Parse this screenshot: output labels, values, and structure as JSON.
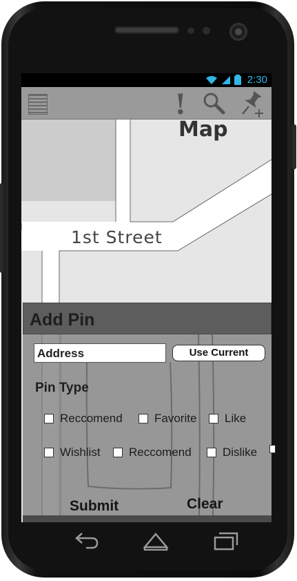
{
  "status_bar": {
    "time": "2:30",
    "icons": [
      "wifi-icon",
      "signal-icon",
      "battery-icon"
    ]
  },
  "action_bar": {
    "icons": [
      "menu-icon",
      "alert-icon",
      "search-icon",
      "add-pin-icon"
    ],
    "alert_glyph": "!"
  },
  "map": {
    "title": "Map",
    "street_label": "1st Street"
  },
  "add_pin": {
    "title": "Add Pin",
    "address_placeholder": "Address",
    "use_current_label": "Use Current",
    "pin_type_label": "Pin Type",
    "options": [
      {
        "label": "Reccomend",
        "checked": false
      },
      {
        "label": "Favorite",
        "checked": false
      },
      {
        "label": "Like",
        "checked": false
      },
      {
        "label": "Wishlist",
        "checked": false
      },
      {
        "label": "Reccomend",
        "checked": false
      },
      {
        "label": "Dislike",
        "checked": false
      }
    ],
    "submit_label": "Submit",
    "clear_label": "Clear"
  },
  "nav_bar": {
    "icons": [
      "back-icon",
      "home-icon",
      "recent-apps-icon"
    ]
  },
  "colors": {
    "status_accent": "#33b5e5",
    "panel_header": "#5d5d5d",
    "action_bar": "#9a9a9a"
  }
}
